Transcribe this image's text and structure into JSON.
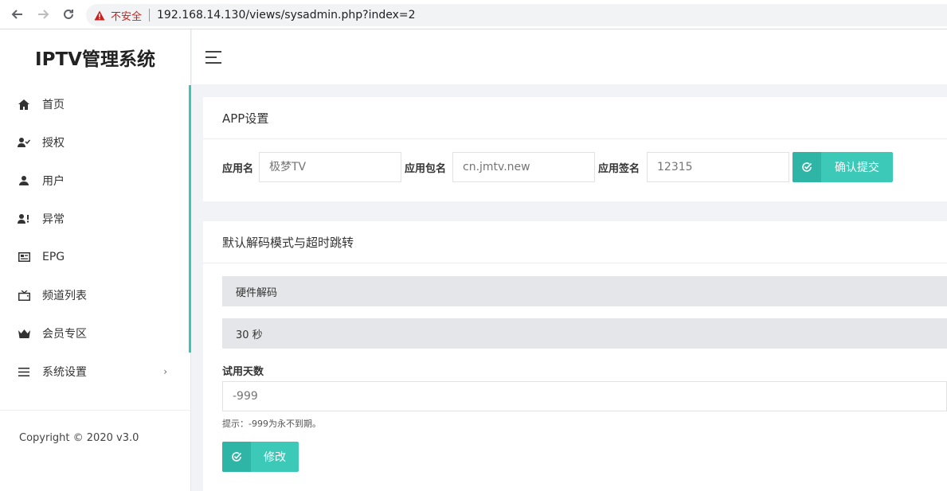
{
  "browser": {
    "back_icon": "arrow-left-icon",
    "forward_icon": "arrow-right-icon",
    "reload_icon": "reload-icon",
    "security_label": "不安全",
    "url": "192.168.14.130/views/sysadmin.php?index=2"
  },
  "sidebar": {
    "brand": "IPTV管理系统",
    "items": [
      {
        "label": "首页",
        "icon": "home-icon"
      },
      {
        "label": "授权",
        "icon": "user-check-icon"
      },
      {
        "label": "用户",
        "icon": "user-icon"
      },
      {
        "label": "异常",
        "icon": "user-alert-icon"
      },
      {
        "label": "EPG",
        "icon": "epg-icon"
      },
      {
        "label": "频道列表",
        "icon": "tv-icon"
      },
      {
        "label": "会员专区",
        "icon": "crown-icon"
      },
      {
        "label": "系统设置",
        "icon": "menu-lines-icon"
      }
    ],
    "copyright": "Copyright © 2020 v3.0"
  },
  "app_settings": {
    "title": "APP设置",
    "app_name_label": "应用名",
    "app_name_placeholder": "极梦TV",
    "package_label": "应用包名",
    "package_placeholder": "cn.jmtv.new",
    "signature_label": "应用签名",
    "signature_placeholder": "12315",
    "submit_label": "确认提交"
  },
  "decode_settings": {
    "title": "默认解码模式与超时跳转",
    "decode_mode": "硬件解码",
    "timeout": "30 秒",
    "trial_label": "试用天数",
    "trial_placeholder": "-999",
    "hint": "提示：-999为永不到期。",
    "modify_label": "修改"
  },
  "colors": {
    "accent": "#3cc9b8",
    "accent_dark": "#2fb5a5",
    "warning": "#c5221f"
  }
}
